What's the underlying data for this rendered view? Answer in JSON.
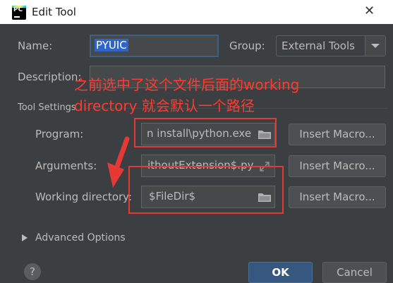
{
  "window": {
    "title": "Edit Tool",
    "close_glyph": "✕",
    "app_icon": "pycharm-icon",
    "app_icon_text": "PC"
  },
  "form": {
    "name_label": "Name:",
    "name_value": "PYUIC",
    "group_label": "Group:",
    "group_value": "External Tools",
    "description_label": "Description:",
    "description_value": "",
    "tool_settings_label": "Tool Settings",
    "program_label": "Program:",
    "program_value": "n install\\python.exe",
    "arguments_label": "Arguments:",
    "arguments_value": "ithoutExtension$.py",
    "working_dir_label": "Working directory:",
    "working_dir_value": "$FileDir$",
    "insert_macro_label": "Insert Macro...",
    "advanced_label": "Advanced Options"
  },
  "annotation": {
    "line1": "之前选中了这个文件后面的working",
    "line2": "directory 就会默认一个路径",
    "color": "#ff3b30"
  },
  "footer": {
    "help_glyph": "?",
    "ok_label": "OK",
    "cancel_label": "Cancel"
  },
  "colors": {
    "background": "#3c3f41",
    "field": "#45494a",
    "primary_button": "#365880",
    "selection": "#2f65ca",
    "annotation_box": "#e53935"
  }
}
